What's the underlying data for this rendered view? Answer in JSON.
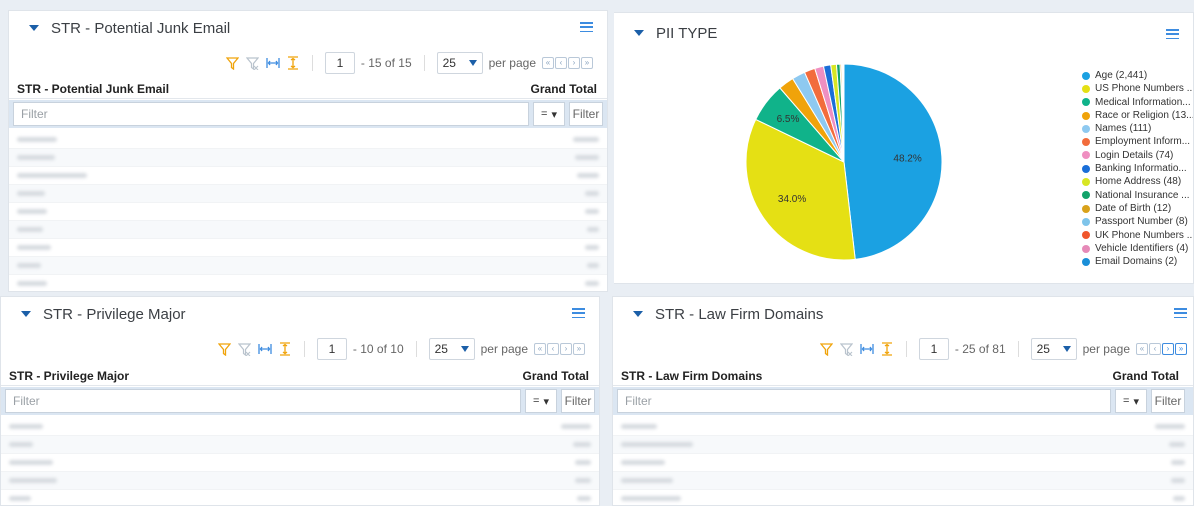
{
  "junk": {
    "title": "STR - Potential Junk Email",
    "page": "1",
    "range": "- 15 of 15",
    "per_page_value": "25",
    "per_page_label": "per page",
    "col1": "STR - Potential Junk Email",
    "col2": "Grand Total",
    "filter_placeholder": "Filter",
    "filter_op": "=",
    "filter_button": "Filter"
  },
  "pii": {
    "title": "PII TYPE"
  },
  "priv": {
    "title": "STR - Privilege Major",
    "page": "1",
    "range": "- 10 of 10",
    "per_page_value": "25",
    "per_page_label": "per page",
    "col1": "STR - Privilege Major",
    "col2": "Grand Total",
    "filter_placeholder": "Filter",
    "filter_op": "=",
    "filter_button": "Filter"
  },
  "law": {
    "title": "STR - Law Firm Domains",
    "page": "1",
    "range": "- 25 of 81",
    "per_page_value": "25",
    "per_page_label": "per page",
    "col1": "STR - Law Firm Domains",
    "col2": "Grand Total",
    "filter_placeholder": "Filter",
    "filter_op": "=",
    "filter_button": "Filter"
  },
  "chart_data": {
    "type": "pie",
    "title": "PII TYPE",
    "slices": [
      {
        "legend": "Age (2,441)",
        "value": 2441,
        "color": "#1ba1e2",
        "label": "48.2%"
      },
      {
        "legend": "US Phone Numbers ...",
        "value": 1722,
        "color": "#e5e014",
        "label": "34.0%"
      },
      {
        "legend": "Medical Information...",
        "value": 329,
        "color": "#10b38a",
        "label": "6.5%"
      },
      {
        "legend": "Race or Religion (13...",
        "value": 130,
        "color": "#f0a30a",
        "label": ""
      },
      {
        "legend": "Names (111)",
        "value": 111,
        "color": "#8ec9f0",
        "label": ""
      },
      {
        "legend": "Employment Inform...",
        "value": 90,
        "color": "#f26c3c",
        "label": ""
      },
      {
        "legend": "Login Details (74)",
        "value": 74,
        "color": "#ef8fc1",
        "label": ""
      },
      {
        "legend": "Banking Informatio...",
        "value": 60,
        "color": "#1a6ed8",
        "label": ""
      },
      {
        "legend": "Home Address (48)",
        "value": 48,
        "color": "#d8e624",
        "label": ""
      },
      {
        "legend": "National Insurance ...",
        "value": 30,
        "color": "#12a36a",
        "label": ""
      },
      {
        "legend": "Date of Birth (12)",
        "value": 12,
        "color": "#d9a21b",
        "label": ""
      },
      {
        "legend": "Passport Number (8)",
        "value": 8,
        "color": "#7ec4ea",
        "label": ""
      },
      {
        "legend": "UK Phone Numbers ...",
        "value": 6,
        "color": "#f0562c",
        "label": ""
      },
      {
        "legend": "Vehicle Identifiers (4)",
        "value": 4,
        "color": "#e68ab8",
        "label": ""
      },
      {
        "legend": "Email Domains (2)",
        "value": 2,
        "color": "#1a8fd8",
        "label": ""
      }
    ],
    "legend_position": "right"
  }
}
